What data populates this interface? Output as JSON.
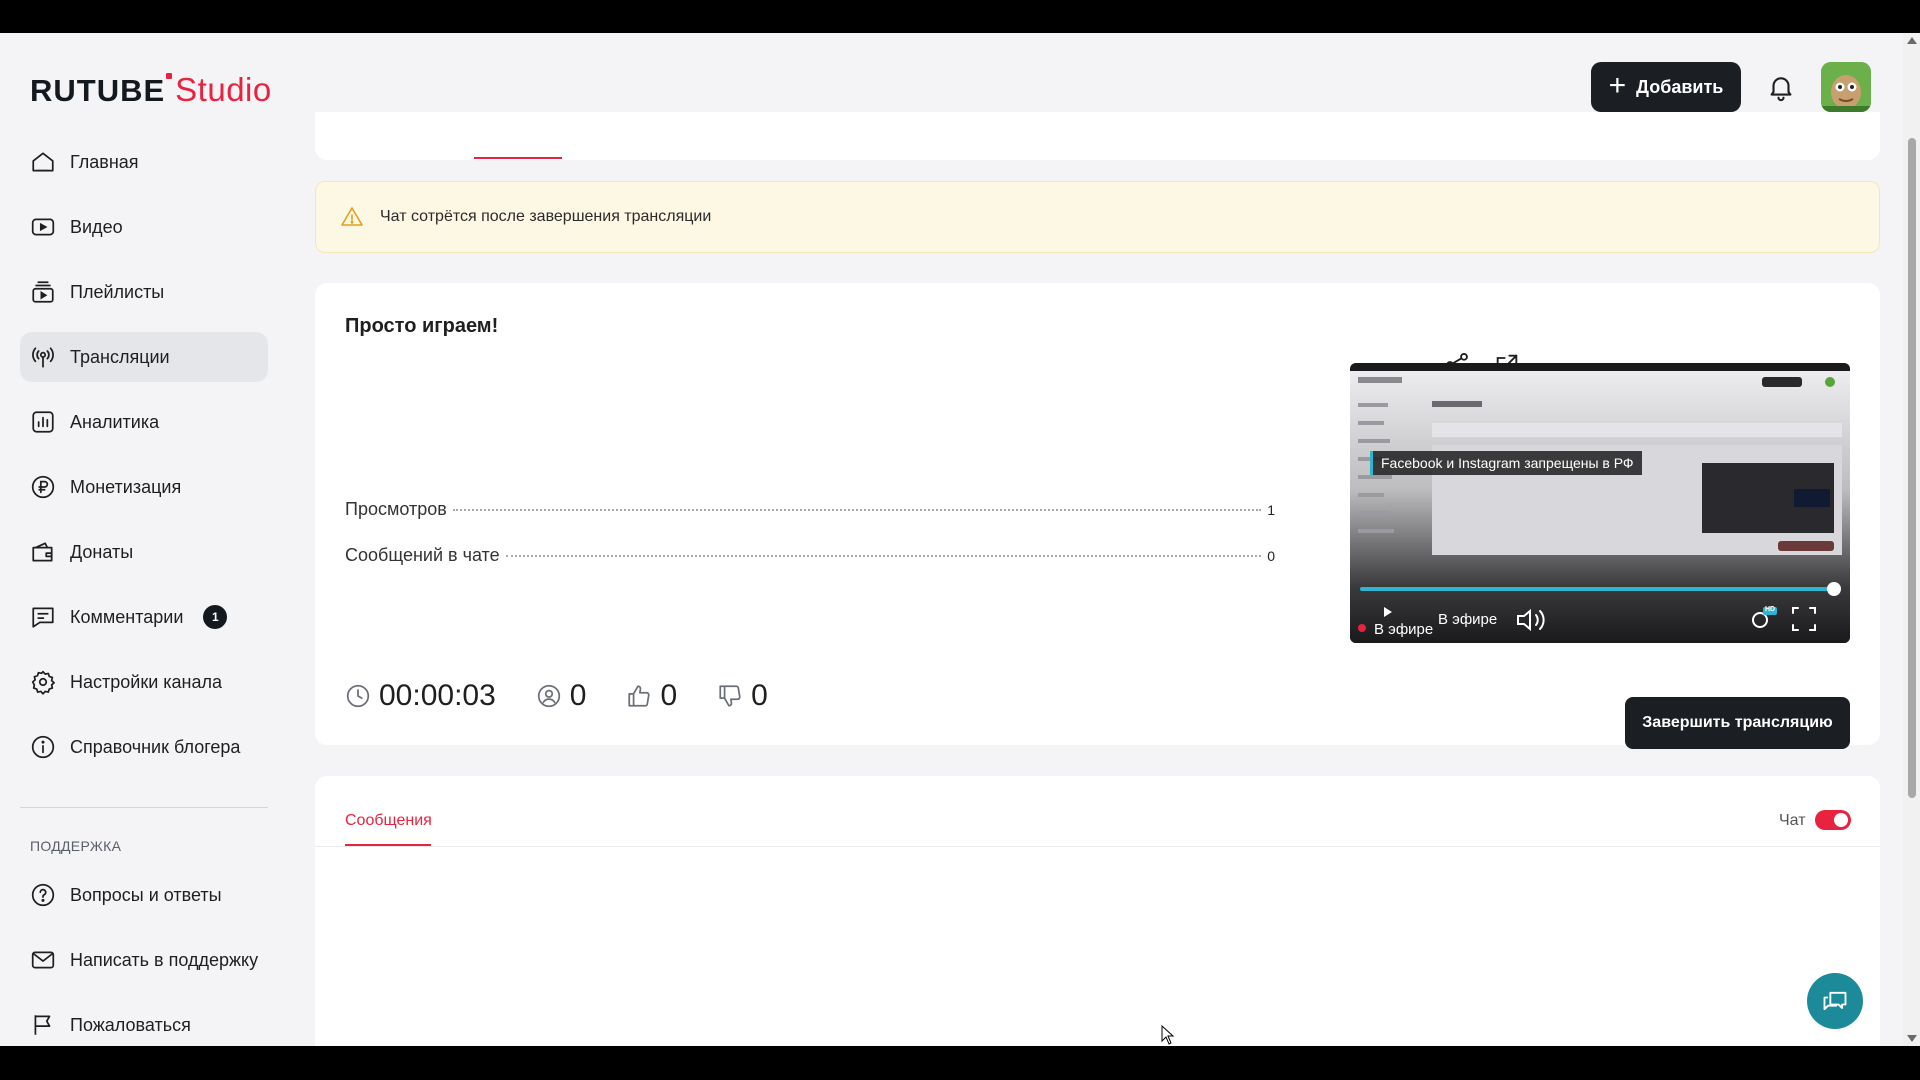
{
  "header": {
    "logo_main": "RUTUBE",
    "logo_sub": "Studio",
    "add_button": "Добавить",
    "brand_color": "#e8233f"
  },
  "sidebar": {
    "items": [
      {
        "label": "Главная",
        "icon": "home-icon"
      },
      {
        "label": "Видео",
        "icon": "video-icon"
      },
      {
        "label": "Плейлисты",
        "icon": "playlist-icon"
      },
      {
        "label": "Трансляции",
        "icon": "broadcast-icon",
        "active": true
      },
      {
        "label": "Аналитика",
        "icon": "analytics-icon"
      },
      {
        "label": "Монетизация",
        "icon": "ruble-icon"
      },
      {
        "label": "Донаты",
        "icon": "wallet-icon"
      },
      {
        "label": "Комментарии",
        "icon": "comment-icon",
        "badge": "1"
      },
      {
        "label": "Настройки канала",
        "icon": "gear-icon"
      },
      {
        "label": "Справочник блогера",
        "icon": "info-icon"
      }
    ],
    "support_title": "ПОДДЕРЖКА",
    "support_items": [
      {
        "label": "Вопросы и ответы",
        "icon": "question-icon"
      },
      {
        "label": "Написать в поддержку",
        "icon": "mail-icon"
      },
      {
        "label": "Пожаловаться",
        "icon": "flag-icon"
      }
    ]
  },
  "warning": {
    "text": "Чат сотрётся после завершения трансляции"
  },
  "stream": {
    "title": "Просто играем!",
    "stats": [
      {
        "label": "Просмотров",
        "value": "1"
      },
      {
        "label": "Сообщений в чате",
        "value": "0"
      }
    ],
    "metrics": {
      "duration": "00:00:03",
      "viewers": "0",
      "likes": "0",
      "dislikes": "0"
    },
    "player": {
      "overlay_text": "Facebook и Instagram запрещены в РФ",
      "live_label": "В эфире",
      "live_label_partial": "В эфире",
      "quality_badge": "HD"
    },
    "end_button": "Завершить трансляцию"
  },
  "chat": {
    "tab_label": "Сообщения",
    "toggle_label": "Чат",
    "toggle_on": true
  }
}
